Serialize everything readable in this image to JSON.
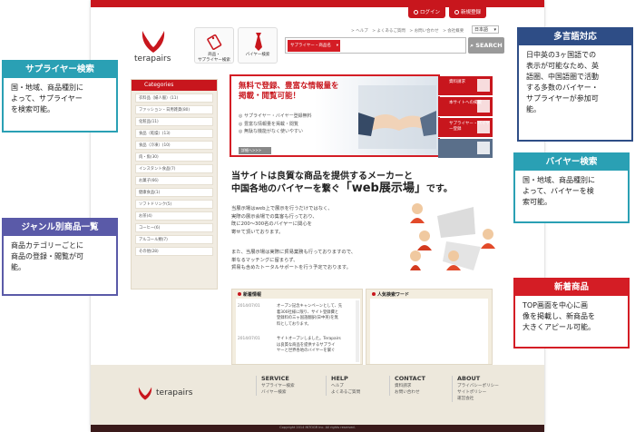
{
  "top_bar": {
    "login": "ログイン",
    "register": "新規登録"
  },
  "logo": {
    "text": "terapairs"
  },
  "category_buttons": [
    {
      "label1": "商品・",
      "label2": "サプライヤー検索"
    },
    {
      "label1": "バイヤー検索",
      "label2": ""
    }
  ],
  "top_links": "> ヘルプ　> よくあるご質問　> お問い合わせ　> 会社概要",
  "language": {
    "selected": "日本語"
  },
  "search": {
    "category": "サプライヤー・商品名",
    "button": "SEARCH"
  },
  "sidebar": {
    "heading": "Categories",
    "items": [
      "衣料品（婦人服）(11)",
      "ファッション・日用雑貨(80)",
      "化粧品(11)",
      "食品（乾燥）(13)",
      "食品（冷凍）(10)",
      "肉・魚(30)",
      "インスタント食品(7)",
      "お菓子(66)",
      "健康食品(1)",
      "ソフトドリンク(5)",
      "お茶(4)",
      "コーヒー(6)",
      "アルコール類(7)",
      "その他(28)"
    ]
  },
  "banner": {
    "title_line1": "無料で登録、豊富な情報量を",
    "title_line2": "掲載・閲覧可能！",
    "features": [
      "サプライヤー・バイヤー登録無料",
      "豊富な情報量を掲載・閲覧",
      "無駄な機能がなく使いやすい"
    ],
    "button": "詳細へ>>>",
    "side_items": [
      "資料請求",
      "本サイトへの掲載",
      "サプライヤー・バイヤー登録",
      ""
    ]
  },
  "headline": {
    "line1": "当サイトは良質な商品を提供するメーカーと",
    "line2_a": "中国各地のバイヤーを繋ぐ",
    "line2_b": "「web展示場」",
    "line2_c": "です。"
  },
  "paragraph1": [
    "当展示場はweb上で展示を行うだけではなく、",
    "実際の展示会場での集客も行っており、",
    "既に200〜300名のバイヤーに関心を",
    "寄せて頂いております。"
  ],
  "paragraph2": [
    "また、当展示場は実際に貿易業務も行っておりますので、",
    "単なるマッチングに留まらず、",
    "貿易も含めたトータルサポートを行う予定でおります。"
  ],
  "news": {
    "heading": "新着情報",
    "items": [
      {
        "date": "2014/07/01",
        "text1": "オープン記念キャンペーンとして、先",
        "text2": "着300社様に限り、サイト登録費と",
        "text3": "登録料の三ヶ国語翻訳(日中英)を無",
        "text4": "料としております。"
      },
      {
        "date": "2014/07/01",
        "text1": "サイトオープンしました。Terapairs",
        "text2": "は良質な商品を提供するサプライ",
        "text3": "ヤーと世界各地のバイヤーを繋ぐ",
        "text4": ""
      }
    ]
  },
  "keywords": {
    "heading": "人気検索ワード"
  },
  "footer": {
    "columns": [
      {
        "heading": "SERVICE",
        "links": [
          "サプライヤー検索",
          "バイヤー検索"
        ]
      },
      {
        "heading": "HELP",
        "links": [
          "ヘルプ",
          "よくあるご質問"
        ]
      },
      {
        "heading": "CONTACT",
        "links": [
          "資料請求",
          "お問い合わせ"
        ]
      },
      {
        "heading": "ABOUT",
        "links": [
          "プライバシーポリシー",
          "サイトポリシー",
          "運営会社"
        ]
      }
    ],
    "copyright": "Copyright 2014 INTOGR Inc. All rights reserved."
  },
  "callouts": {
    "supplier": {
      "title": "サプライヤー検索",
      "text": [
        "国・地域、商品種別に",
        "よって、サプライヤー",
        "を検索可能。"
      ]
    },
    "genre": {
      "title": "ジャンル別商品一覧",
      "text": [
        "商品カテゴリーごとに",
        "商品の登録・閲覧が可",
        "能。"
      ]
    },
    "multilang": {
      "title": "多言語対応",
      "text": [
        "日中英の3ヶ国語での",
        "表示が可能なため、英",
        "語圏、中国語圏で活動",
        "する多数のバイヤー・",
        "サプライヤーが参加可",
        "能。"
      ]
    },
    "buyer": {
      "title": "バイヤー検索",
      "text": [
        "国・地域、商品種別に",
        "よって、バイヤーを検",
        "索可能。"
      ]
    },
    "newproducts": {
      "title": "新着商品",
      "text": [
        "TOP画面を中心に画",
        "像を掲載し、新商品を",
        "大きくアピール可能。"
      ]
    }
  },
  "colors": {
    "brand_red": "#c8161d",
    "teal": "#2aa0b4",
    "navy": "#2e4d86",
    "purple": "#5a5aa8"
  }
}
